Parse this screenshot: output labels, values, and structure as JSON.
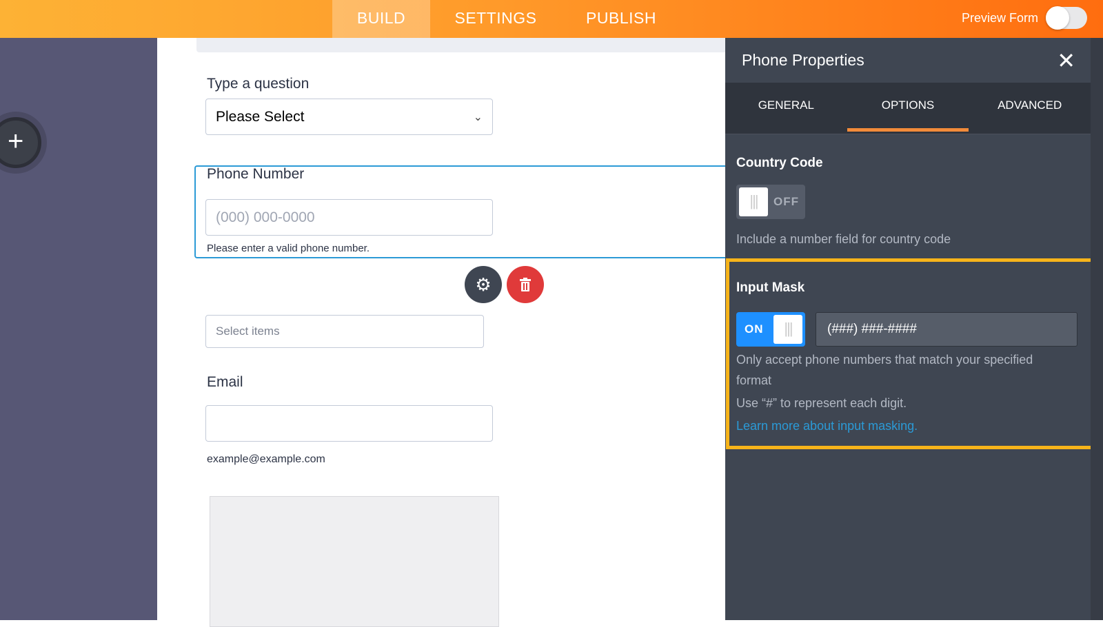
{
  "topbar": {
    "tabs": [
      "BUILD",
      "SETTINGS",
      "PUBLISH"
    ],
    "active_tab": "BUILD",
    "preview_label": "Preview Form",
    "preview_on": false
  },
  "form": {
    "question_label": "Type a question",
    "question_select": "Please Select",
    "phone_label": "Phone Number",
    "phone_placeholder": "(000) 000-0000",
    "phone_sublabel": "Please enter a valid phone number.",
    "select_items_placeholder": "Select items",
    "email_label": "Email",
    "email_value": "",
    "email_sublabel": "example@example.com"
  },
  "panel": {
    "title": "Phone Properties",
    "tabs": [
      "GENERAL",
      "OPTIONS",
      "ADVANCED"
    ],
    "active_tab": "OPTIONS",
    "country_code": {
      "title": "Country Code",
      "toggle": "OFF",
      "description": "Include a number field for country code"
    },
    "input_mask": {
      "title": "Input Mask",
      "toggle": "ON",
      "value": "(###) ###-####",
      "description": "Only accept phone numbers that match your specified format",
      "hint": "Use “#” to represent each digit.",
      "link": "Learn more about input masking."
    }
  },
  "colors": {
    "accent": "#ff7a1a",
    "highlight": "#f7b41a",
    "link": "#2b9ad6",
    "toggle_on": "#1e90ff",
    "delete": "#e03a3a"
  }
}
